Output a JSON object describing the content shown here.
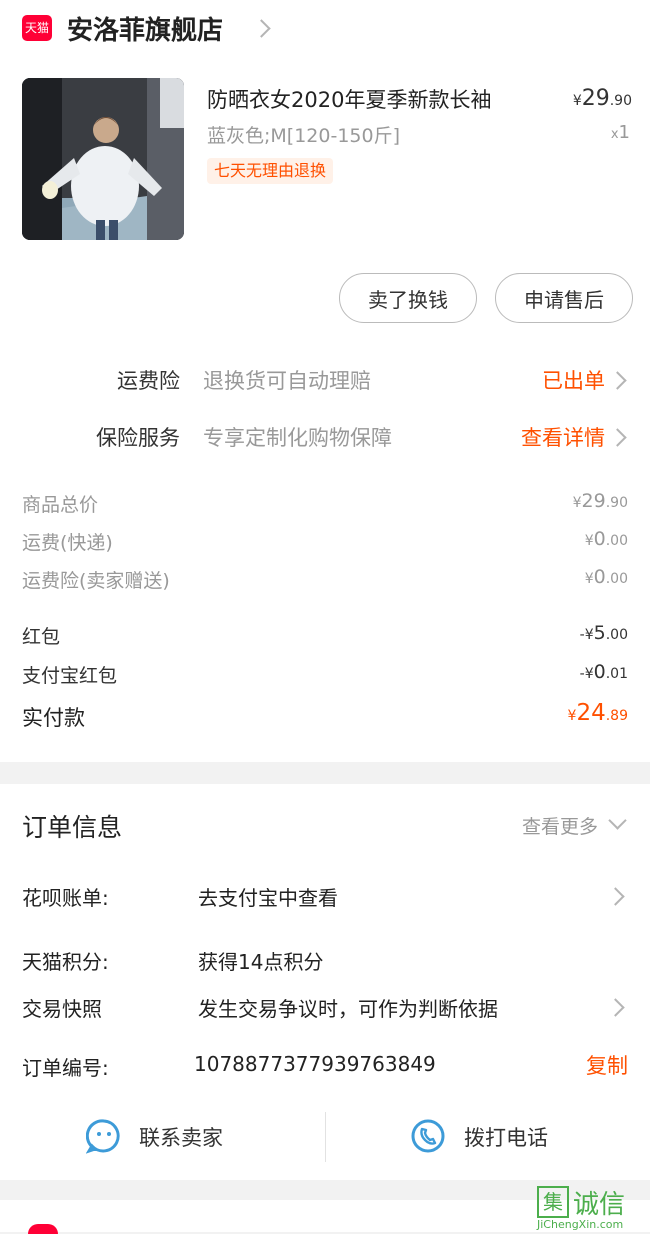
{
  "store": {
    "badge": "天猫",
    "name": "安洛菲旗舰店"
  },
  "product": {
    "title": "防晒衣女2020年夏季新款长袖",
    "spec": "蓝灰色;M[120-150斤]",
    "tag": "七天无理由退换",
    "price_int": "29",
    "price_dec": ".90",
    "currency": "¥",
    "qty": "1",
    "qty_prefix": "x"
  },
  "actions": {
    "sell": "卖了换钱",
    "after_sale": "申请售后"
  },
  "services": [
    {
      "label": "运费险",
      "desc": "退换货可自动理赔",
      "status": "已出单"
    },
    {
      "label": "保险服务",
      "desc": "专享定制化购物保障",
      "status": "查看详情"
    }
  ],
  "costs": [
    {
      "label": "商品总价",
      "prefix": "¥",
      "int": "29",
      "dec": ".90"
    },
    {
      "label": "运费(快递)",
      "prefix": "¥",
      "int": "0",
      "dec": ".00"
    },
    {
      "label": "运费险(卖家赠送)",
      "prefix": "¥",
      "int": "0",
      "dec": ".00"
    }
  ],
  "discounts": [
    {
      "label": "红包",
      "prefix": "-¥",
      "int": "5",
      "dec": ".00"
    },
    {
      "label": "支付宝红包",
      "prefix": "-¥",
      "int": "0",
      "dec": ".01"
    }
  ],
  "paid": {
    "label": "实付款",
    "prefix": "¥",
    "int": "24",
    "dec": ".89"
  },
  "order_info": {
    "title": "订单信息",
    "more": "查看更多",
    "rows": [
      {
        "label": "花呗账单:",
        "value": "去支付宝中查看"
      },
      {
        "label": "天猫积分:",
        "value": "获得14点积分"
      },
      {
        "label": "交易快照",
        "value": "发生交易争议时，可作为判断依据"
      },
      {
        "label": "订单编号:",
        "value": "1078877377939763849",
        "action": "复制"
      }
    ]
  },
  "contact": {
    "seller": "联系卖家",
    "call": "拨打电话"
  },
  "watermark": {
    "char1": "集",
    "char2": "诚信",
    "url": "JiChengXin.com"
  },
  "colors": {
    "accent": "#ff5000",
    "tmall_red": "#ff0036",
    "blue_icon": "#3d9bd8"
  }
}
